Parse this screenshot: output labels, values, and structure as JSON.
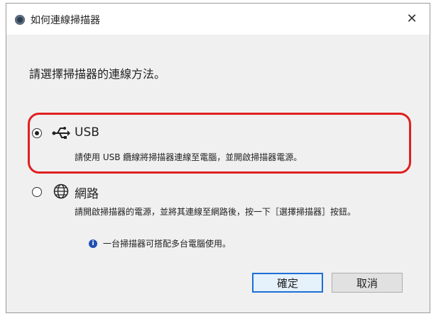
{
  "dialog": {
    "title": "如何連線掃描器",
    "close_label": "✕"
  },
  "prompt": "請選擇掃描器的連線方法。",
  "options": [
    {
      "id": "usb",
      "label": "USB",
      "icon": "usb-icon",
      "selected": true,
      "description": "請使用 USB 纜線將掃描器連線至電腦，並開啟掃描器電源。"
    },
    {
      "id": "network",
      "label": "網路",
      "icon": "globe-icon",
      "selected": false,
      "description": "請開啟掃描器的電源，並將其連線至網路後，按一下［選擇掃描器］按鈕。",
      "note": "一台掃描器可搭配多台電腦使用。",
      "note_icon": "info-icon"
    }
  ],
  "buttons": {
    "ok_label": "確定",
    "cancel_label": "取消"
  },
  "colors": {
    "highlight": "#e02020",
    "info": "#1f4fb3",
    "default_button_border": "#1d6fd6"
  }
}
